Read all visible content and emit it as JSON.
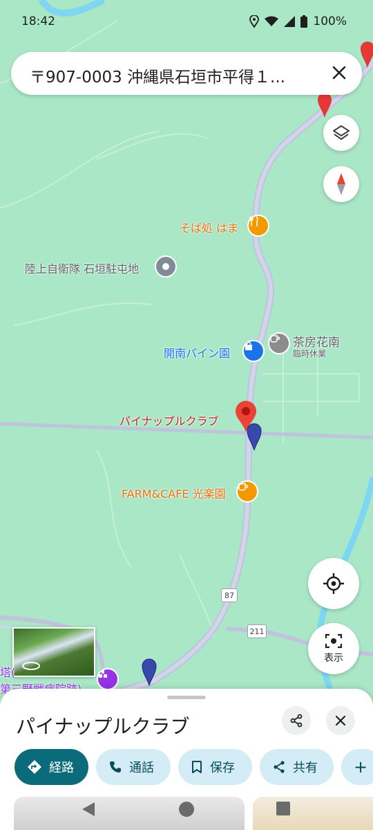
{
  "status_bar": {
    "time": "18:42",
    "battery": "100%"
  },
  "search": {
    "query": "〒907-0003 沖縄県石垣市平得１..."
  },
  "map": {
    "places": [
      {
        "name": "そば処 はま",
        "type": "restaurant",
        "color": "#e8710a"
      },
      {
        "name": "陸上自衛隊 石垣駐屯地",
        "type": "landmark",
        "color": "#5f6368"
      },
      {
        "name": "茶房花南",
        "sub": "臨時休業",
        "type": "cafe",
        "color": "#5f6368"
      },
      {
        "name": "開南パイン園",
        "type": "shopping",
        "color": "#1a73e8"
      },
      {
        "name": "パイナップルクラブ",
        "type": "selected",
        "color": "#c5221f"
      },
      {
        "name": "FARM&CAFE 光楽園",
        "type": "cafe",
        "color": "#e8710a"
      },
      {
        "name": "塔(",
        "type": "memorial",
        "color": "#9334e6"
      },
      {
        "name": "第三野戦病院跡)",
        "type": "memorial",
        "color": "#9334e6"
      }
    ],
    "road_shields": [
      "87",
      "211"
    ],
    "view_label": "表示"
  },
  "sheet": {
    "title": "パイナップルクラブ",
    "actions": [
      {
        "label": "経路",
        "icon": "directions-icon"
      },
      {
        "label": "通話",
        "icon": "phone-icon"
      },
      {
        "label": "保存",
        "icon": "bookmark-icon"
      },
      {
        "label": "共有",
        "icon": "share-icon"
      },
      {
        "label": "+",
        "icon": "plus-icon"
      }
    ]
  },
  "colors": {
    "map_bg": "#a9e7c7",
    "road": "#c6c9e0",
    "accent": "#0b6b7b",
    "chip_bg": "#d3ecf5"
  }
}
